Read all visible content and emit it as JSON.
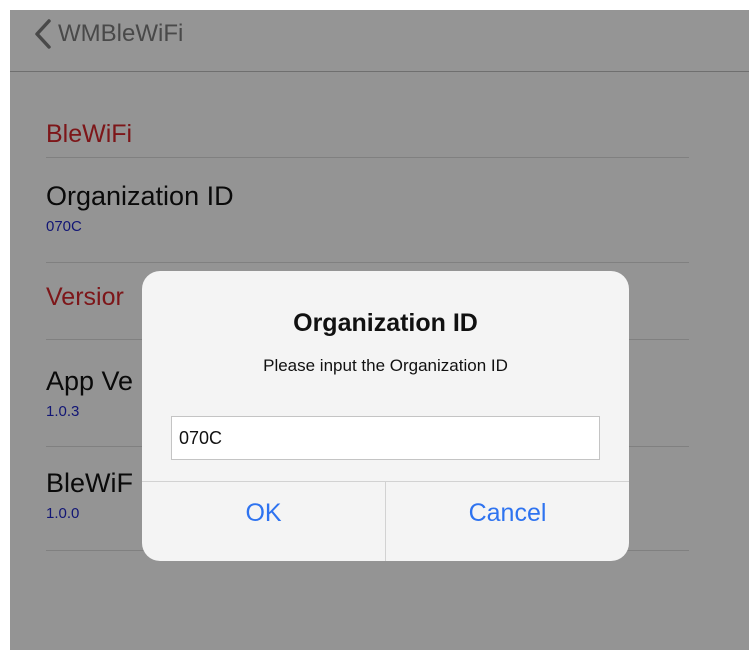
{
  "navbar": {
    "back_label": "WMBleWiFi",
    "back_icon": "chevron-left-icon"
  },
  "list": {
    "section_blewifi": "BleWiFi",
    "org_id_title": "Organization ID",
    "org_id_value": "070C",
    "section_version": "Versior",
    "app_version_title": "App Ve",
    "app_version_value": "1.0.3",
    "blewifi_version_title": "BleWiF",
    "blewifi_version_value": "1.0.0"
  },
  "dialog": {
    "title": "Organization ID",
    "message": "Please input the Organization ID",
    "input_value": "070C",
    "ok_label": "OK",
    "cancel_label": "Cancel"
  },
  "colors": {
    "section_header": "#d0262b",
    "value_text": "#1f26c4",
    "button_text": "#2e73f0"
  }
}
